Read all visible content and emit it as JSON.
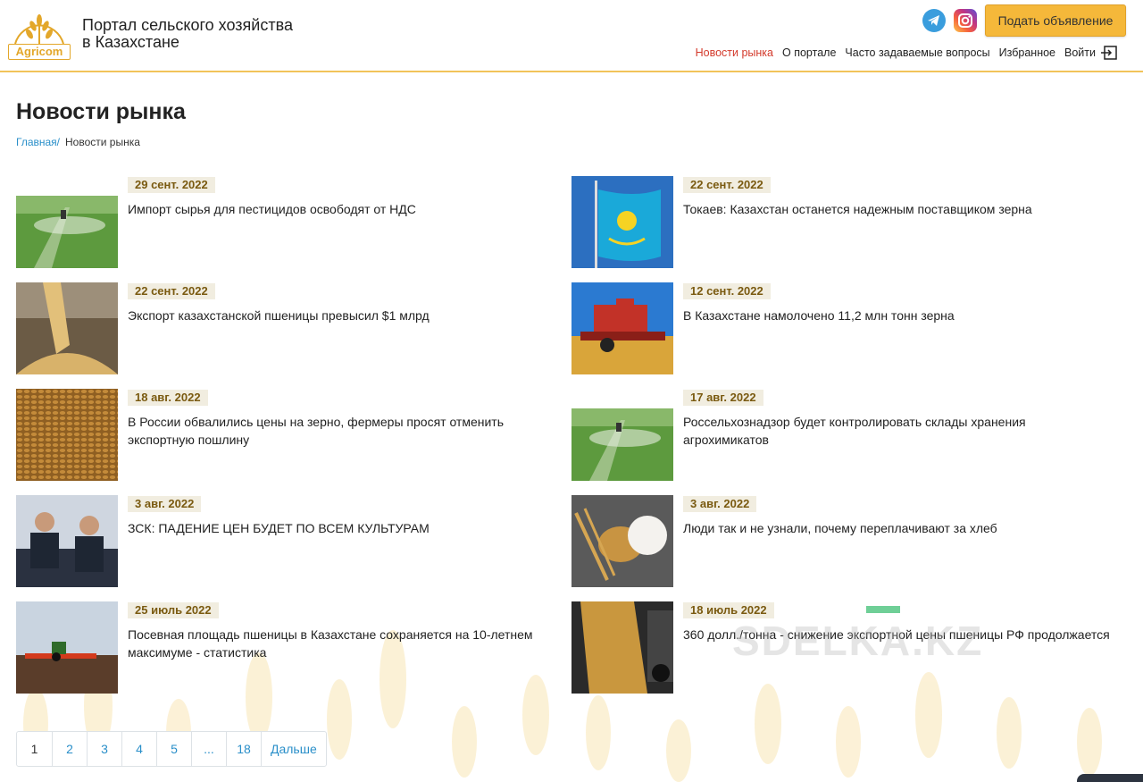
{
  "header": {
    "logo_text": "Agricom",
    "site_title": "Портал сельского хозяйства в Казахстане",
    "cta_label": "Подать объявление",
    "nav": [
      "Новости рынка",
      "О портале",
      "Часто задаваемые вопросы",
      "Избранное",
      "Войти"
    ]
  },
  "page": {
    "title": "Новости рынка",
    "breadcrumb_home": "Главная/",
    "breadcrumb_current": "Новости рынка"
  },
  "news": [
    {
      "date": "29 сент. 2022",
      "title": "Импорт сырья для пестицидов освободят от НДС",
      "thumb": "sprayer-field-icon"
    },
    {
      "date": "22 сент. 2022",
      "title": "Токаев: Казахстан останется надежным поставщиком зерна",
      "thumb": "kazakhstan-flag-icon"
    },
    {
      "date": "22 сент. 2022",
      "title": "Экспорт казахстанской пшеницы превысил $1 млрд",
      "thumb": "grain-pour-icon"
    },
    {
      "date": "12 сент. 2022",
      "title": "В Казахстане намолочено 11,2 млн тонн зерна",
      "thumb": "combine-harvester-icon"
    },
    {
      "date": "18 авг. 2022",
      "title": "В России обвалились цены на зерно, фермеры просят отменить экспортную пошлину",
      "thumb": "grain-closeup-icon"
    },
    {
      "date": "17 авг. 2022",
      "title": "Россельхознадзор будет контролировать склады хранения агрохимикатов",
      "thumb": "sprayer-field-icon"
    },
    {
      "date": "3 авг. 2022",
      "title": "ЗСК: ПАДЕНИЕ ЦЕН БУДЕТ ПО ВСЕМ КУЛЬТУРАМ",
      "thumb": "press-conference-icon"
    },
    {
      "date": "3 авг. 2022",
      "title": "Люди так и не узнали, почему переплачивают за хлеб",
      "thumb": "wheat-flour-icon"
    },
    {
      "date": "25 июль 2022",
      "title": "Посевная площадь пшеницы в Казахстане сохраняется на 10-летнем максимуме - статистика",
      "thumb": "tractor-field-icon"
    },
    {
      "date": "18 июль 2022",
      "title": "360 долл./тонна - снижение экспортной цены пшеницы РФ продолжается",
      "thumb": "grain-truck-icon"
    }
  ],
  "pagination": [
    "1",
    "2",
    "3",
    "4",
    "5",
    "...",
    "18",
    "Дальше"
  ],
  "watermark": "SDELKA.KZ",
  "colors": {
    "accent": "#f5b83a",
    "active_nav": "#d33a2c",
    "link": "#2a8fc9"
  }
}
